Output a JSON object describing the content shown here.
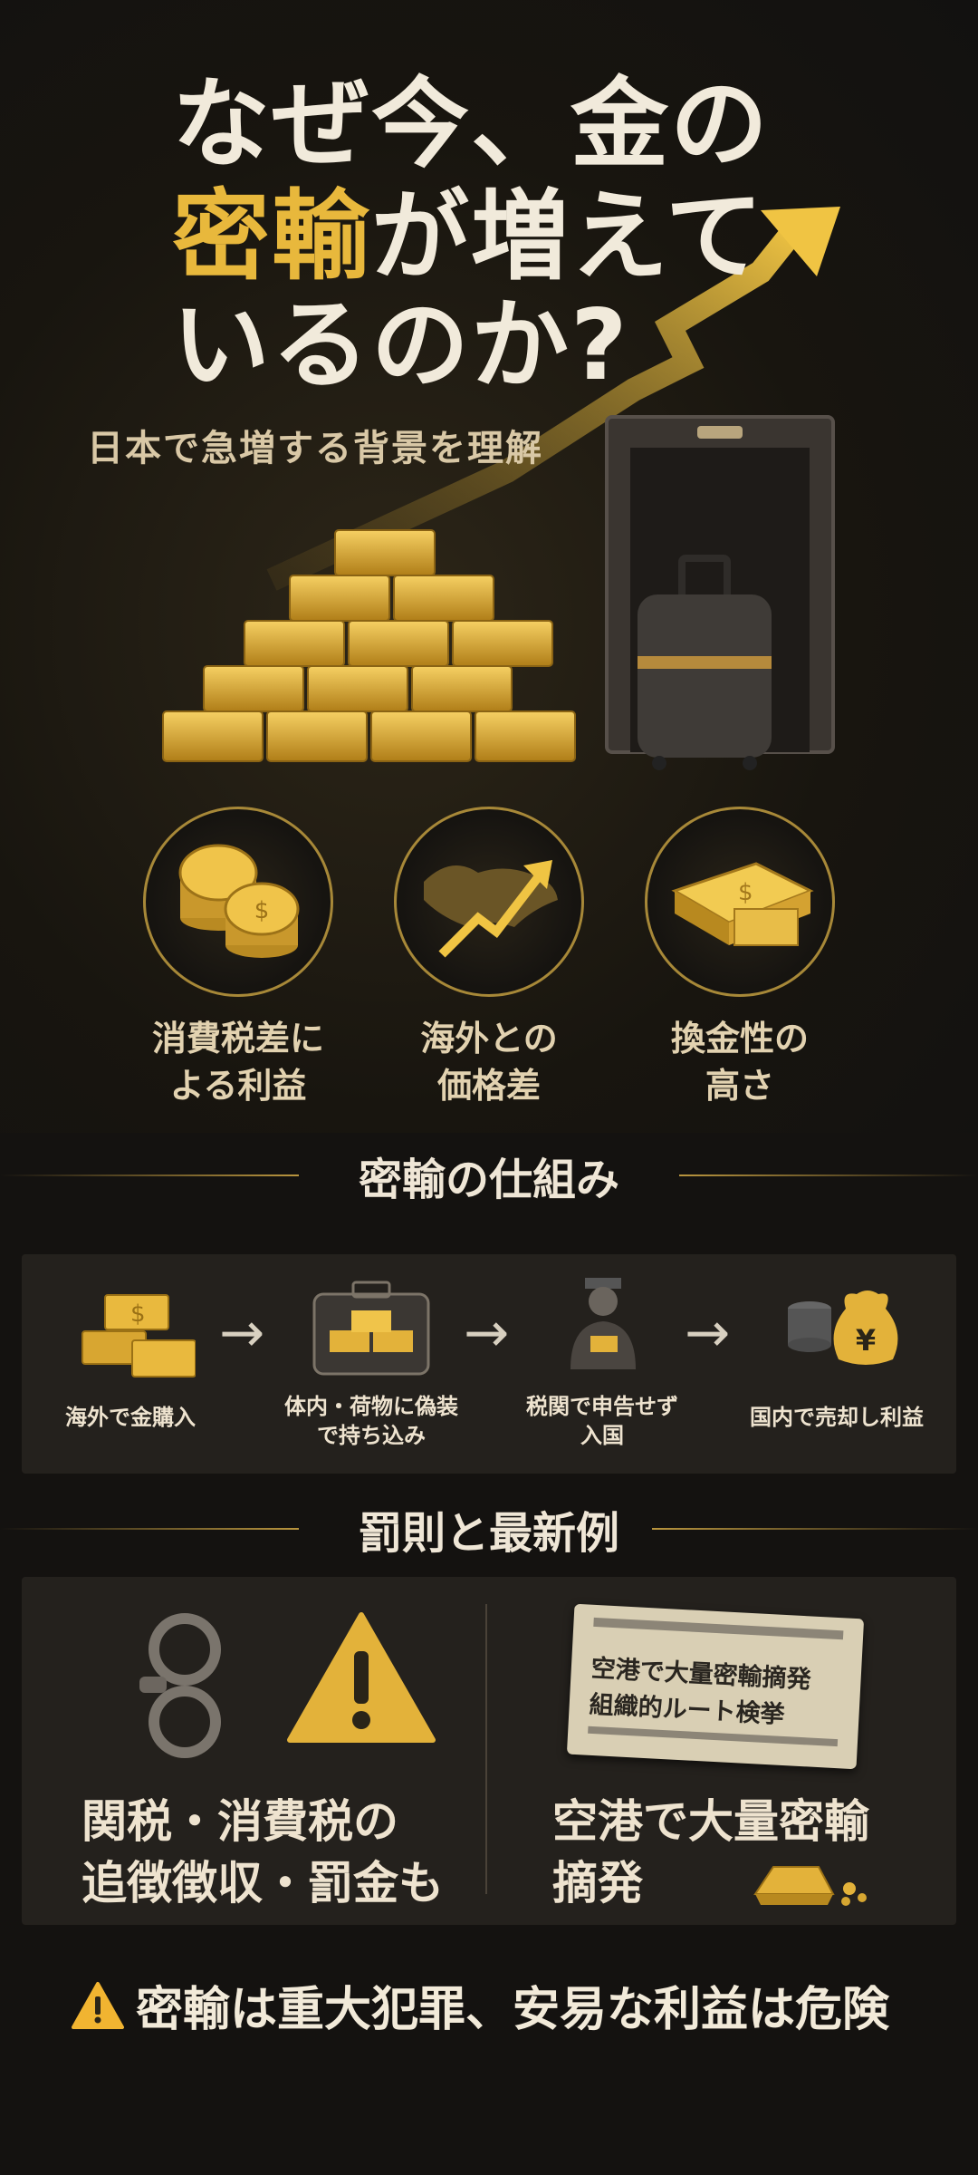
{
  "title": {
    "line1": "なぜ今、金の",
    "line2_highlight": "密輸",
    "line2_rest": "が増えて",
    "line3": "いるのか?"
  },
  "subtitle": "日本で急増する背景を理解",
  "features": [
    {
      "icon": "coins-icon",
      "label_line1": "消費税差に",
      "label_line2": "よる利益"
    },
    {
      "icon": "world-price-arrow-icon",
      "label_line1": "海外との",
      "label_line2": "価格差"
    },
    {
      "icon": "cash-bundle-icon",
      "label_line1": "換金性の",
      "label_line2": "高さ"
    }
  ],
  "mechanism": {
    "heading": "密輸の仕組み",
    "steps": [
      {
        "icon": "gold-bars-icon",
        "label_line1": "海外で金購入",
        "label_line2": ""
      },
      {
        "icon": "suitcase-gold-icon",
        "label_line1": "体内・荷物に偽装",
        "label_line2": "で持ち込み"
      },
      {
        "icon": "customs-officer-icon",
        "label_line1": "税関で申告せず",
        "label_line2": "入国"
      },
      {
        "icon": "yen-money-bag-icon",
        "label_line1": "国内で売却し利益",
        "label_line2": ""
      }
    ]
  },
  "penalties": {
    "heading": "罰則と最新例",
    "left_line1": "関税・消費税の",
    "left_line2": "追徴徴収・罰金も",
    "right_line1": "空港で大量密輸",
    "right_line2": "摘発",
    "newspaper_line1": "空港で大量密輸摘発",
    "newspaper_line2": "組織的ルート検挙"
  },
  "warning": "密輸は重大犯罪、安易な利益は危険",
  "colors": {
    "gold": "#e8b83c",
    "background": "#141210",
    "panel": "#24211d"
  }
}
